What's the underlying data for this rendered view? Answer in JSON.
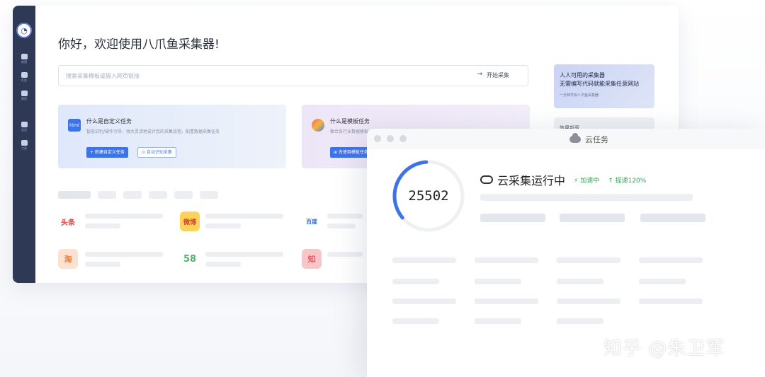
{
  "app": {
    "greeting": "你好，欢迎使用八爪鱼采集器!",
    "search": {
      "placeholder": "搜索采集模板或输入网页链接",
      "button": "开始采集",
      "arrow": "→"
    },
    "sidebar": {
      "items": [
        {
          "label": "新建",
          "icon": "new-icon"
        },
        {
          "label": "任务",
          "icon": "task-icon"
        },
        {
          "label": "教程",
          "icon": "tutorial-icon"
        },
        {
          "label": "会员",
          "icon": "vip-icon"
        },
        {
          "label": "工具",
          "icon": "tool-icon"
        }
      ]
    },
    "cards": [
      {
        "icon": "html",
        "title": "什么是自定义任务",
        "desc": "智能识别/操作引导，强大灵活地设计您的采集流程，配置数据采集任务",
        "primary": "+ 新建自定义任务",
        "secondary": "⊙ 自动识别采集"
      },
      {
        "icon": "",
        "title": "什么是模板任务",
        "desc": "聚合各行业数据模板，简单配置即可采集",
        "primary": "⊞ 去使用模板任务",
        "secondary": ""
      }
    ],
    "promo": {
      "line1": "人人可用的采集器",
      "line2": "无需编写代码就能采集任意网站",
      "line3": "一分钟学会八爪鱼采集器"
    },
    "promo2": {
      "title": "效果新版"
    },
    "brands": [
      {
        "name": "头条",
        "color": "#e8403a"
      },
      {
        "name": "微博",
        "color": "#f5a623"
      },
      {
        "name": "百度",
        "color": "#2f6ee5"
      },
      {
        "name": "淘",
        "color": "#f07a3a"
      },
      {
        "name": "58",
        "color": "#55b36b"
      },
      {
        "name": "知",
        "color": "#e8575b"
      }
    ]
  },
  "cloud_window": {
    "title": "云任务",
    "counter": "25502",
    "counter_progress": 0.35,
    "status": "云采集运行中",
    "badge_speed": "⚡ 加速中",
    "badge_rate": "↑ 提速120%"
  },
  "watermark": "知乎 @朱卫军",
  "colors": {
    "accent": "#3d73e8",
    "sidebar": "#2e3a55",
    "success": "#2fa84f"
  }
}
